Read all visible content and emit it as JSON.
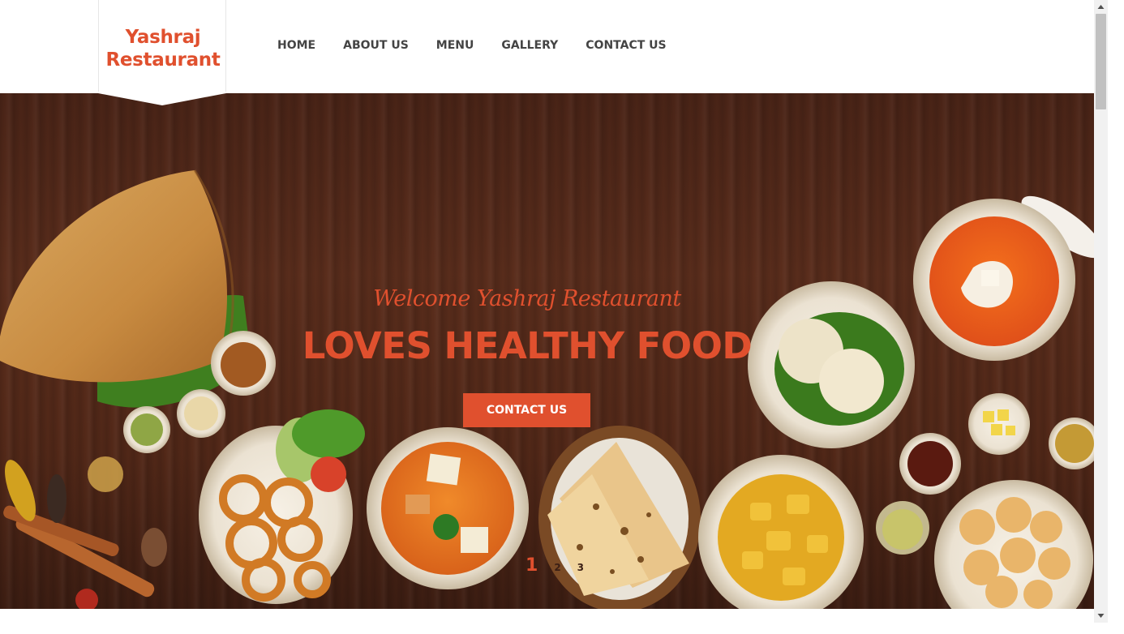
{
  "brand": {
    "name_line1": "Yashraj",
    "name_line2": "Restaurant",
    "color": "#e0502e"
  },
  "nav": {
    "items": [
      {
        "label": "HOME"
      },
      {
        "label": "ABOUT US"
      },
      {
        "label": "MENU"
      },
      {
        "label": "GALLERY"
      },
      {
        "label": "CONTACT US"
      }
    ]
  },
  "hero": {
    "tagline": "Welcome Yashraj Restaurant",
    "headline": "LOVES HEALTHY FOOD",
    "cta_label": "CONTACT US",
    "accent_color": "#e0502e",
    "slides": [
      {
        "label": "1",
        "active": true
      },
      {
        "label": "2",
        "active": false
      },
      {
        "label": "3",
        "active": false
      }
    ]
  },
  "icons": {
    "scroll_up": "triangle-up-icon",
    "scroll_down": "triangle-down-icon"
  }
}
